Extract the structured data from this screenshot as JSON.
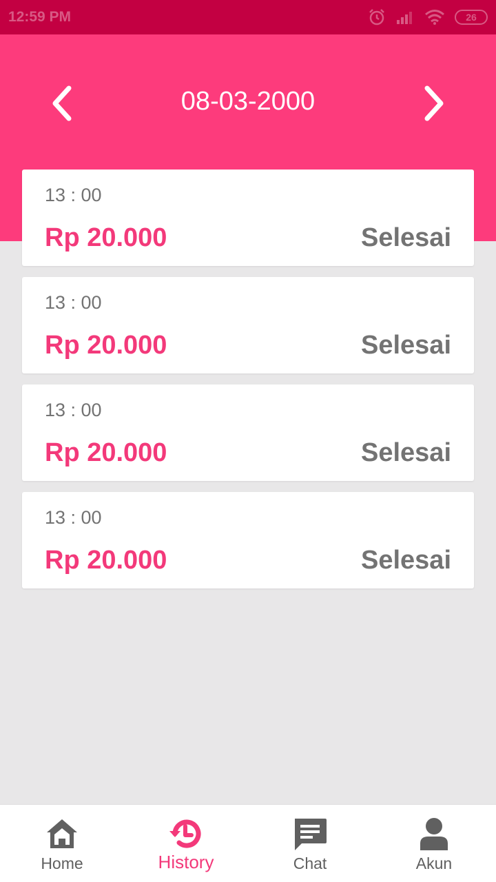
{
  "status_bar": {
    "time": "12:59 PM",
    "battery": "26"
  },
  "header": {
    "date": "08-03-2000"
  },
  "transactions": [
    {
      "time": "13 : 00",
      "amount": "Rp 20.000",
      "status": "Selesai"
    },
    {
      "time": "13 : 00",
      "amount": "Rp 20.000",
      "status": "Selesai"
    },
    {
      "time": "13 : 00",
      "amount": "Rp 20.000",
      "status": "Selesai"
    },
    {
      "time": "13 : 00",
      "amount": "Rp 20.000",
      "status": "Selesai"
    }
  ],
  "bottom_nav": {
    "items": [
      {
        "label": "Home",
        "icon": "home-icon"
      },
      {
        "label": "History",
        "icon": "history-icon",
        "active": true
      },
      {
        "label": "Chat",
        "icon": "chat-icon"
      },
      {
        "label": "Akun",
        "icon": "account-icon"
      }
    ]
  },
  "colors": {
    "primary": "#fd3b7c",
    "status_bar": "#c30042",
    "accent_text": "#f3397a",
    "muted_text": "#737373",
    "background": "#e8e7e8"
  }
}
